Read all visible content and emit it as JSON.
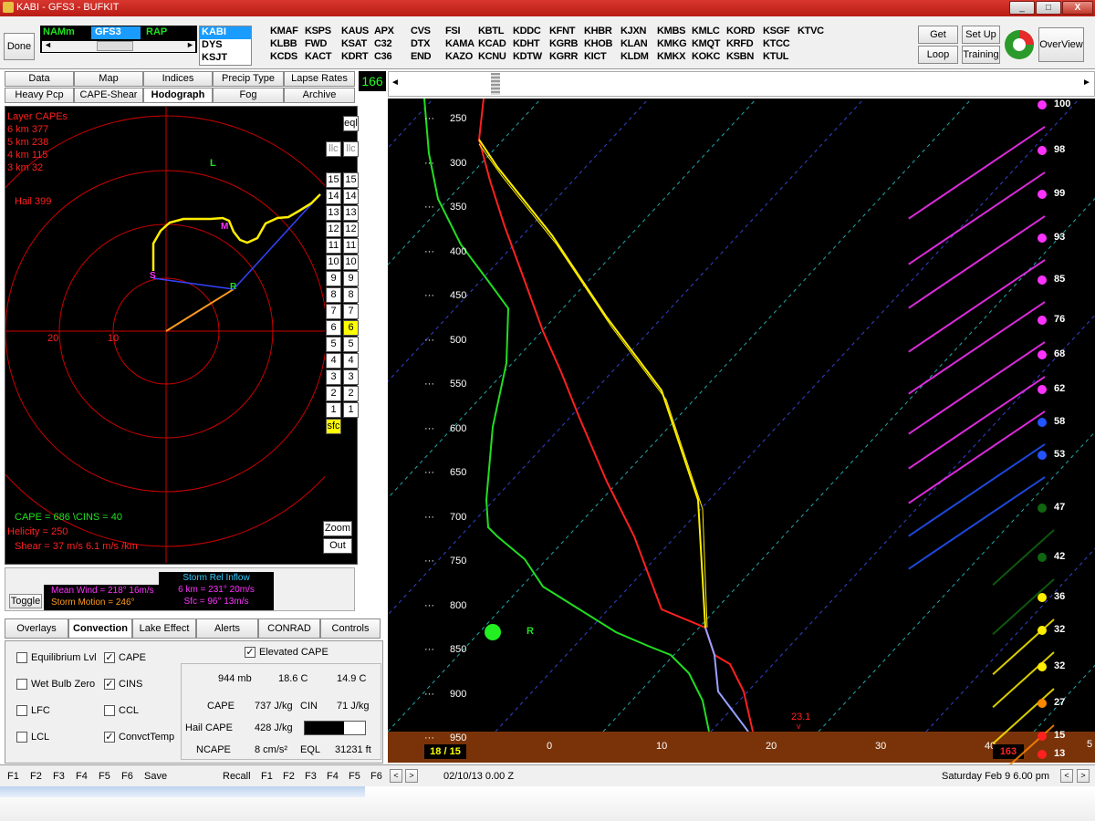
{
  "window": {
    "title": "KABI - GFS3 - BUFKIT",
    "minimize": "_",
    "maximize": "□",
    "close": "X"
  },
  "toolbar": {
    "done": "Done",
    "models": [
      "NAMm",
      "GFS3",
      "RAP"
    ],
    "stations_left": [
      "KABI",
      "DYS",
      "KSJT"
    ],
    "station_grid": [
      [
        "KMAF",
        "KSPS",
        "KAUS",
        "APX",
        "CVS",
        "FSI",
        "KBTL",
        "KDDC",
        "KFNT",
        "KHBR",
        "KJXN",
        "KMBS",
        "KMLC",
        "KORD",
        "KSGF",
        "KTVC"
      ],
      [
        "KLBB",
        "FWD",
        "KSAT",
        "C32",
        "DTX",
        "KAMA",
        "KCAD",
        "KDHT",
        "KGRB",
        "KHOB",
        "KLAN",
        "KMKG",
        "KMQT",
        "KRFD",
        "KTCC",
        ""
      ],
      [
        "KCDS",
        "KACT",
        "KDRT",
        "C36",
        "END",
        "KAZO",
        "KCNU",
        "KDTW",
        "KGRR",
        "KICT",
        "KLDM",
        "KMKX",
        "KOKC",
        "KSBN",
        "KTUL",
        ""
      ]
    ],
    "get_data": "Get Data",
    "loop": "Loop",
    "set_up": "Set Up",
    "training": "Training",
    "overview": "OverView"
  },
  "tabs_row1": [
    "Data",
    "Map",
    "Indices",
    "Precip Type",
    "Lapse Rates"
  ],
  "tabs_row2": [
    "Heavy Pcp",
    "CAPE-Shear",
    "Hodograph",
    "Fog",
    "Archive"
  ],
  "frame_counter": "166",
  "hodograph": {
    "layer_capes_title": "Layer CAPEs",
    "layer_capes": [
      "6 km  377",
      "5 km  238",
      "4 km  115",
      "3 km  32"
    ],
    "hail": "Hail  399",
    "ring_labels": [
      "20",
      "10"
    ],
    "marker_L": "L",
    "marker_M": "M",
    "marker_R": "R",
    "marker_S": "S",
    "cape_cins": "CAPE =  686 \\CINS =  40",
    "helicity": "Helicity =  250",
    "shear": "Shear =  37 m/s    6.1 m/s /km",
    "eql_btn": "eql",
    "llc_left": "llc",
    "llc_right": "llc",
    "height_buttons_left": [
      "15",
      "14",
      "13",
      "12",
      "11",
      "10",
      "9",
      "8",
      "7",
      "6",
      "5",
      "4",
      "3",
      "2",
      "1",
      "sfc"
    ],
    "height_buttons_right": [
      "15",
      "14",
      "13",
      "12",
      "11",
      "10",
      "9",
      "8",
      "7",
      "6",
      "5",
      "4",
      "3",
      "2",
      "1"
    ],
    "zoom": "Zoom",
    "out": "Out"
  },
  "wind_info": {
    "toggle": "Toggle",
    "mean_wind": "Mean Wind = 218°  16m/s",
    "storm_motion": "Storm Motion = 246°",
    "sri_title": "Storm Rel Inflow",
    "sri_6km": "6 km = 231°  20m/s",
    "sri_sfc": "Sfc  = 96°  13m/s"
  },
  "lower_tabs": [
    "Overlays",
    "Convection",
    "Lake Effect",
    "Alerts",
    "CONRAD",
    "Controls"
  ],
  "convection": {
    "checks": [
      {
        "label": "Equilibrium Lvl",
        "checked": false
      },
      {
        "label": "CAPE",
        "checked": true
      },
      {
        "label": "Wet Bulb Zero",
        "checked": false
      },
      {
        "label": "CINS",
        "checked": true
      },
      {
        "label": "LFC",
        "checked": false
      },
      {
        "label": "CCL",
        "checked": false
      },
      {
        "label": "LCL",
        "checked": false
      },
      {
        "label": "ConvctTemp",
        "checked": true
      }
    ],
    "elevated": "Elevated CAPE",
    "p": "944 mb",
    "t": "18.6 C",
    "td": "14.9 C",
    "cape_lbl": "CAPE",
    "cape_val": "737 J/kg",
    "cin_lbl": "CIN",
    "cin_val": "71 J/kg",
    "hail_lbl": "Hail CAPE",
    "hail_val": "428 J/kg",
    "ncape_lbl": "NCAPE",
    "ncape_val": "8 cm/s²",
    "eql_lbl": "EQL",
    "eql_val": "31231 ft"
  },
  "fkeys_left": [
    "F1",
    "F2",
    "F3",
    "F4",
    "F5",
    "F6",
    "Save"
  ],
  "fkeys_right": [
    "Recall",
    "F1",
    "F2",
    "F3",
    "F4",
    "F5",
    "F6"
  ],
  "skewt": {
    "pressures": [
      "250",
      "300",
      "350",
      "400",
      "450",
      "500",
      "550",
      "600",
      "650",
      "700",
      "750",
      "800",
      "850",
      "900",
      "950"
    ],
    "temps": [
      "0",
      "10",
      "20",
      "30",
      "40"
    ],
    "tbox": "18 / 15",
    "marker_R": "R",
    "surface_label": "23.1",
    "surface_arrow": "v",
    "speed_box": "163",
    "wind_speeds": [
      "100",
      "98",
      "99",
      "93",
      "85",
      "76",
      "68",
      "62",
      "58",
      "53",
      "47",
      "42",
      "36",
      "32",
      "32",
      "27",
      "15",
      "13"
    ],
    "scroll_label": "5"
  },
  "status": {
    "date": "02/10/13   0.00 Z",
    "valid": "Saturday   Feb 9  6.00 pm"
  }
}
